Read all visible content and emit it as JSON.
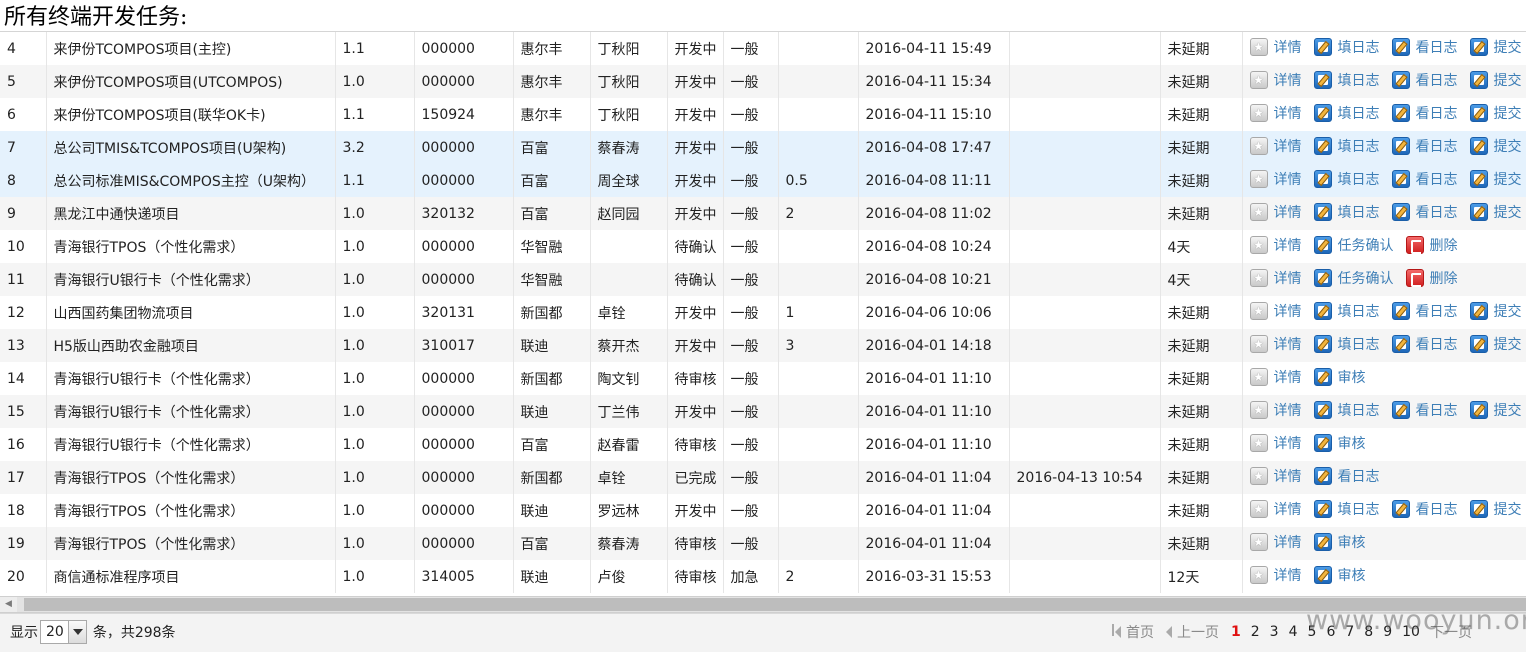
{
  "page": {
    "title": "所有终端开发任务:"
  },
  "actions": {
    "detail": "详情",
    "fill_log": "填日志",
    "view_log": "看日志",
    "submit": "提交",
    "task_confirm": "任务确认",
    "delete": "删除",
    "review": "审核"
  },
  "rows": [
    {
      "no": "4",
      "project": "来伊份TCOMPOS项目(主控)",
      "ver": "1.1",
      "code": "000000",
      "company": "惠尔丰",
      "person": "丁秋阳",
      "status": "开发中",
      "priority": "一般",
      "hours": "",
      "created": "2016-04-11 15:49",
      "finished": "",
      "delay": "未延期",
      "actions": [
        "detail",
        "fill_log",
        "view_log",
        "submit"
      ]
    },
    {
      "no": "5",
      "project": "来伊份TCOMPOS项目(UTCOMPOS)",
      "ver": "1.0",
      "code": "000000",
      "company": "惠尔丰",
      "person": "丁秋阳",
      "status": "开发中",
      "priority": "一般",
      "hours": "",
      "created": "2016-04-11 15:34",
      "finished": "",
      "delay": "未延期",
      "actions": [
        "detail",
        "fill_log",
        "view_log",
        "submit"
      ]
    },
    {
      "no": "6",
      "project": "来伊份TCOMPOS项目(联华OK卡)",
      "ver": "1.1",
      "code": "150924",
      "company": "惠尔丰",
      "person": "丁秋阳",
      "status": "开发中",
      "priority": "一般",
      "hours": "",
      "created": "2016-04-11 15:10",
      "finished": "",
      "delay": "未延期",
      "actions": [
        "detail",
        "fill_log",
        "view_log",
        "submit"
      ]
    },
    {
      "no": "7",
      "project": "总公司TMIS&TCOMPOS项目(U架构)",
      "ver": "3.2",
      "code": "000000",
      "company": "百富",
      "person": "蔡春涛",
      "status": "开发中",
      "priority": "一般",
      "hours": "",
      "created": "2016-04-08 17:47",
      "finished": "",
      "delay": "未延期",
      "actions": [
        "detail",
        "fill_log",
        "view_log",
        "submit"
      ]
    },
    {
      "no": "8",
      "project": "总公司标准MIS&COMPOS主控（U架构）",
      "ver": "1.1",
      "code": "000000",
      "company": "百富",
      "person": "周全球",
      "status": "开发中",
      "priority": "一般",
      "hours": "0.5",
      "created": "2016-04-08 11:11",
      "finished": "",
      "delay": "未延期",
      "actions": [
        "detail",
        "fill_log",
        "view_log",
        "submit"
      ]
    },
    {
      "no": "9",
      "project": "黑龙江中通快递项目",
      "ver": "1.0",
      "code": "320132",
      "company": "百富",
      "person": "赵同园",
      "status": "开发中",
      "priority": "一般",
      "hours": "2",
      "created": "2016-04-08 11:02",
      "finished": "",
      "delay": "未延期",
      "actions": [
        "detail",
        "fill_log",
        "view_log",
        "submit"
      ]
    },
    {
      "no": "10",
      "project": "青海银行TPOS（个性化需求）",
      "ver": "1.0",
      "code": "000000",
      "company": "华智融",
      "person": "",
      "status": "待确认",
      "priority": "一般",
      "hours": "",
      "created": "2016-04-08 10:24",
      "finished": "",
      "delay": "4天",
      "actions": [
        "detail",
        "task_confirm",
        "delete"
      ]
    },
    {
      "no": "11",
      "project": "青海银行U银行卡（个性化需求）",
      "ver": "1.0",
      "code": "000000",
      "company": "华智融",
      "person": "",
      "status": "待确认",
      "priority": "一般",
      "hours": "",
      "created": "2016-04-08 10:21",
      "finished": "",
      "delay": "4天",
      "actions": [
        "detail",
        "task_confirm",
        "delete"
      ]
    },
    {
      "no": "12",
      "project": "山西国药集团物流项目",
      "ver": "1.0",
      "code": "320131",
      "company": "新国都",
      "person": "卓铨",
      "status": "开发中",
      "priority": "一般",
      "hours": "1",
      "created": "2016-04-06 10:06",
      "finished": "",
      "delay": "未延期",
      "actions": [
        "detail",
        "fill_log",
        "view_log",
        "submit"
      ]
    },
    {
      "no": "13",
      "project": "H5版山西助农金融项目",
      "ver": "1.0",
      "code": "310017",
      "company": "联迪",
      "person": "蔡开杰",
      "status": "开发中",
      "priority": "一般",
      "hours": "3",
      "created": "2016-04-01 14:18",
      "finished": "",
      "delay": "未延期",
      "actions": [
        "detail",
        "fill_log",
        "view_log",
        "submit"
      ]
    },
    {
      "no": "14",
      "project": "青海银行U银行卡（个性化需求）",
      "ver": "1.0",
      "code": "000000",
      "company": "新国都",
      "person": "陶文钊",
      "status": "待审核",
      "priority": "一般",
      "hours": "",
      "created": "2016-04-01 11:10",
      "finished": "",
      "delay": "未延期",
      "actions": [
        "detail",
        "review"
      ]
    },
    {
      "no": "15",
      "project": "青海银行U银行卡（个性化需求）",
      "ver": "1.0",
      "code": "000000",
      "company": "联迪",
      "person": "丁兰伟",
      "status": "开发中",
      "priority": "一般",
      "hours": "",
      "created": "2016-04-01 11:10",
      "finished": "",
      "delay": "未延期",
      "actions": [
        "detail",
        "fill_log",
        "view_log",
        "submit"
      ]
    },
    {
      "no": "16",
      "project": "青海银行U银行卡（个性化需求）",
      "ver": "1.0",
      "code": "000000",
      "company": "百富",
      "person": "赵春雷",
      "status": "待审核",
      "priority": "一般",
      "hours": "",
      "created": "2016-04-01 11:10",
      "finished": "",
      "delay": "未延期",
      "actions": [
        "detail",
        "review"
      ]
    },
    {
      "no": "17",
      "project": "青海银行TPOS（个性化需求）",
      "ver": "1.0",
      "code": "000000",
      "company": "新国都",
      "person": "卓铨",
      "status": "已完成",
      "priority": "一般",
      "hours": "",
      "created": "2016-04-01 11:04",
      "finished": "2016-04-13 10:54",
      "delay": "未延期",
      "actions": [
        "detail",
        "view_log"
      ]
    },
    {
      "no": "18",
      "project": "青海银行TPOS（个性化需求）",
      "ver": "1.0",
      "code": "000000",
      "company": "联迪",
      "person": "罗远林",
      "status": "开发中",
      "priority": "一般",
      "hours": "",
      "created": "2016-04-01 11:04",
      "finished": "",
      "delay": "未延期",
      "actions": [
        "detail",
        "fill_log",
        "view_log",
        "submit"
      ]
    },
    {
      "no": "19",
      "project": "青海银行TPOS（个性化需求）",
      "ver": "1.0",
      "code": "000000",
      "company": "百富",
      "person": "蔡春涛",
      "status": "待审核",
      "priority": "一般",
      "hours": "",
      "created": "2016-04-01 11:04",
      "finished": "",
      "delay": "未延期",
      "actions": [
        "detail",
        "review"
      ]
    },
    {
      "no": "20",
      "project": "商信通标准程序项目",
      "ver": "1.0",
      "code": "314005",
      "company": "联迪",
      "person": "卢俊",
      "status": "待审核",
      "priority": "加急",
      "hours": "2",
      "created": "2016-03-31 15:53",
      "finished": "",
      "delay": "12天",
      "actions": [
        "detail",
        "review"
      ]
    }
  ],
  "pager": {
    "show_label": "显示",
    "page_size": "20",
    "count_label": "条，共298条",
    "first": "首页",
    "prev": "上一页",
    "pages": [
      "1",
      "2",
      "3",
      "4",
      "5",
      "6",
      "7",
      "8",
      "9",
      "10"
    ],
    "current": "1",
    "next": "下一页"
  },
  "watermark": "www.wooyun.org"
}
